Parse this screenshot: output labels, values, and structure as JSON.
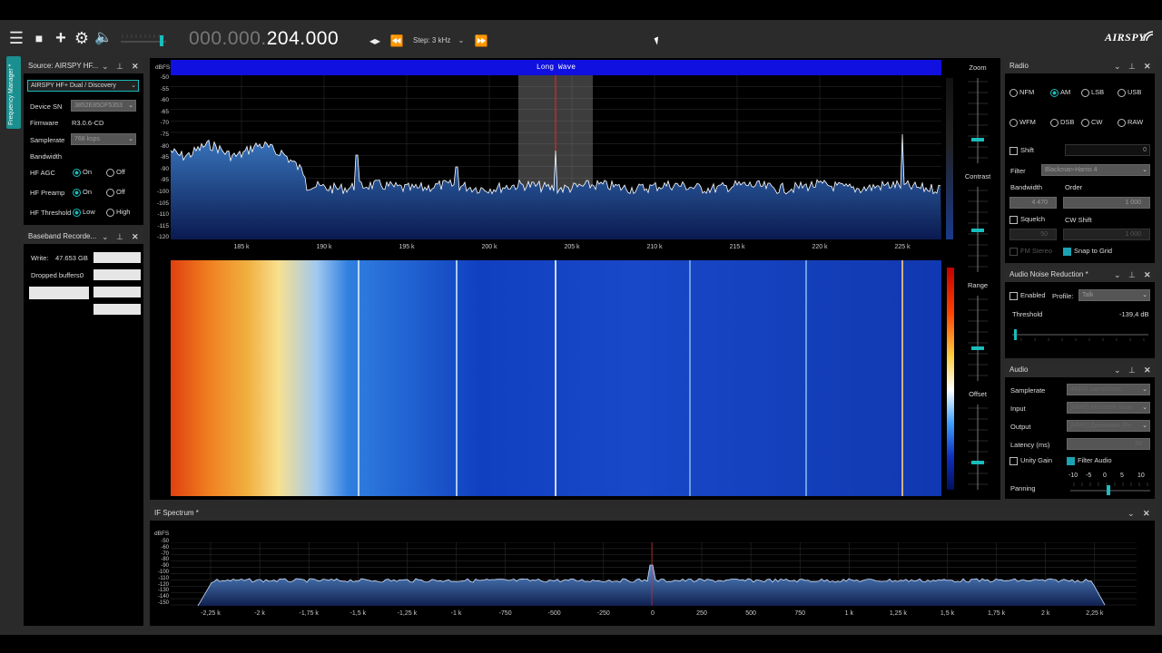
{
  "window": {
    "title": "AIRSPY"
  },
  "toolbar": {
    "freq_dim": "000.000.",
    "freq_main": "204.000",
    "step_label": "Step: 3 kHz",
    "menu_icon": "hamburger-icon",
    "stop_icon": "stop-icon",
    "add_icon": "plus-icon",
    "settings_icon": "gear-icon",
    "volume_icon": "speaker-icon"
  },
  "sidetab": {
    "label": "Frequency Manager *"
  },
  "source": {
    "title": "Source: AIRSPY HF...",
    "device": "AIRSPY HF+ Dual / Discovery",
    "sn_label": "Device SN",
    "sn_value": "3852E85DF5353",
    "fw_label": "Firmware",
    "fw_value": "R3.0.6-CD",
    "sr_label": "Samplerate",
    "sr_value": "768 ksps",
    "bw_label": "Bandwidth",
    "agc_label": "HF AGC",
    "preamp_label": "HF Preamp",
    "thr_label": "HF Threshold",
    "on": "On",
    "off": "Off",
    "low": "Low",
    "high": "High"
  },
  "recorder": {
    "title": "Baseband Recorde...",
    "write_label": "Write:",
    "write_value": "47.653 GB",
    "dropped_label": "Dropped buffers:",
    "dropped_value": "0"
  },
  "fft": {
    "band": "Long Wave",
    "unit": "dBFS",
    "y_ticks": [
      "-50",
      "-55",
      "-60",
      "-65",
      "-70",
      "-75",
      "-80",
      "-85",
      "-90",
      "-95",
      "-100",
      "-105",
      "-110",
      "-115",
      "-120"
    ],
    "x_ticks": [
      "185 k",
      "190 k",
      "195 k",
      "200 k",
      "205 k",
      "210 k",
      "215 k",
      "220 k",
      "225 k"
    ],
    "side_value": "24"
  },
  "sliders": {
    "zoom": "Zoom",
    "contrast": "Contrast",
    "range": "Range",
    "offset": "Offset"
  },
  "radio": {
    "title": "Radio",
    "modes": [
      "NFM",
      "AM",
      "LSB",
      "USB",
      "WFM",
      "DSB",
      "CW",
      "RAW"
    ],
    "selected_mode": "AM",
    "shift_label": "Shift",
    "shift_value": "0",
    "filter_label": "Filter",
    "filter_value": "Blackman-Harris 4",
    "bandwidth_label": "Bandwidth",
    "order_label": "Order",
    "bandwidth_value": "4 470",
    "order_value": "1 000",
    "squelch_label": "Squelch",
    "cwshift_label": "CW Shift",
    "squelch_value": "50",
    "cwshift_value": "1 000",
    "fm_stereo_label": "FM Stereo",
    "snap_label": "Snap to Grid"
  },
  "anr": {
    "title": "Audio Noise Reduction *",
    "enabled_label": "Enabled",
    "profile_label": "Profile:",
    "profile_value": "Talk",
    "threshold_label": "Threshold",
    "threshold_value": "-139,4 dB"
  },
  "audio": {
    "title": "Audio",
    "sr_label": "Samplerate",
    "sr_value": "48000 sample/sec",
    "input_label": "Input",
    "input_value": "[MME] Microsoft Soun",
    "output_label": "Output",
    "output_value": "[MME] Динамики (Re",
    "latency_label": "Latency (ms)",
    "latency_value": "50",
    "unity_label": "Unity Gain",
    "filter_label": "Filter Audio",
    "panning_label": "Panning",
    "pan_ticks": [
      "-10",
      "-5",
      "0",
      "5",
      "10"
    ]
  },
  "ifspectrum": {
    "title": "IF Spectrum *",
    "unit": "dBFS",
    "y_ticks": [
      "-50",
      "-60",
      "-70",
      "-80",
      "-90",
      "-100",
      "-110",
      "-120",
      "-130",
      "-140",
      "-150"
    ],
    "x_ticks": [
      "-2,25 k",
      "-2 k",
      "-1,75 k",
      "-1,5 k",
      "-1,25 k",
      "-1 k",
      "-750",
      "-500",
      "-250",
      "0",
      "250",
      "500",
      "750",
      "1 k",
      "1,25 k",
      "1,5 k",
      "1,75 k",
      "2 k",
      "2,25 k"
    ]
  },
  "colors": {
    "accent": "#1abcbc",
    "band_bar": "#1010e0",
    "trace": "#ffffff",
    "fill_top": "#3a78c0",
    "fill_bottom": "#0a1a50",
    "center_line": "#ff2020"
  }
}
